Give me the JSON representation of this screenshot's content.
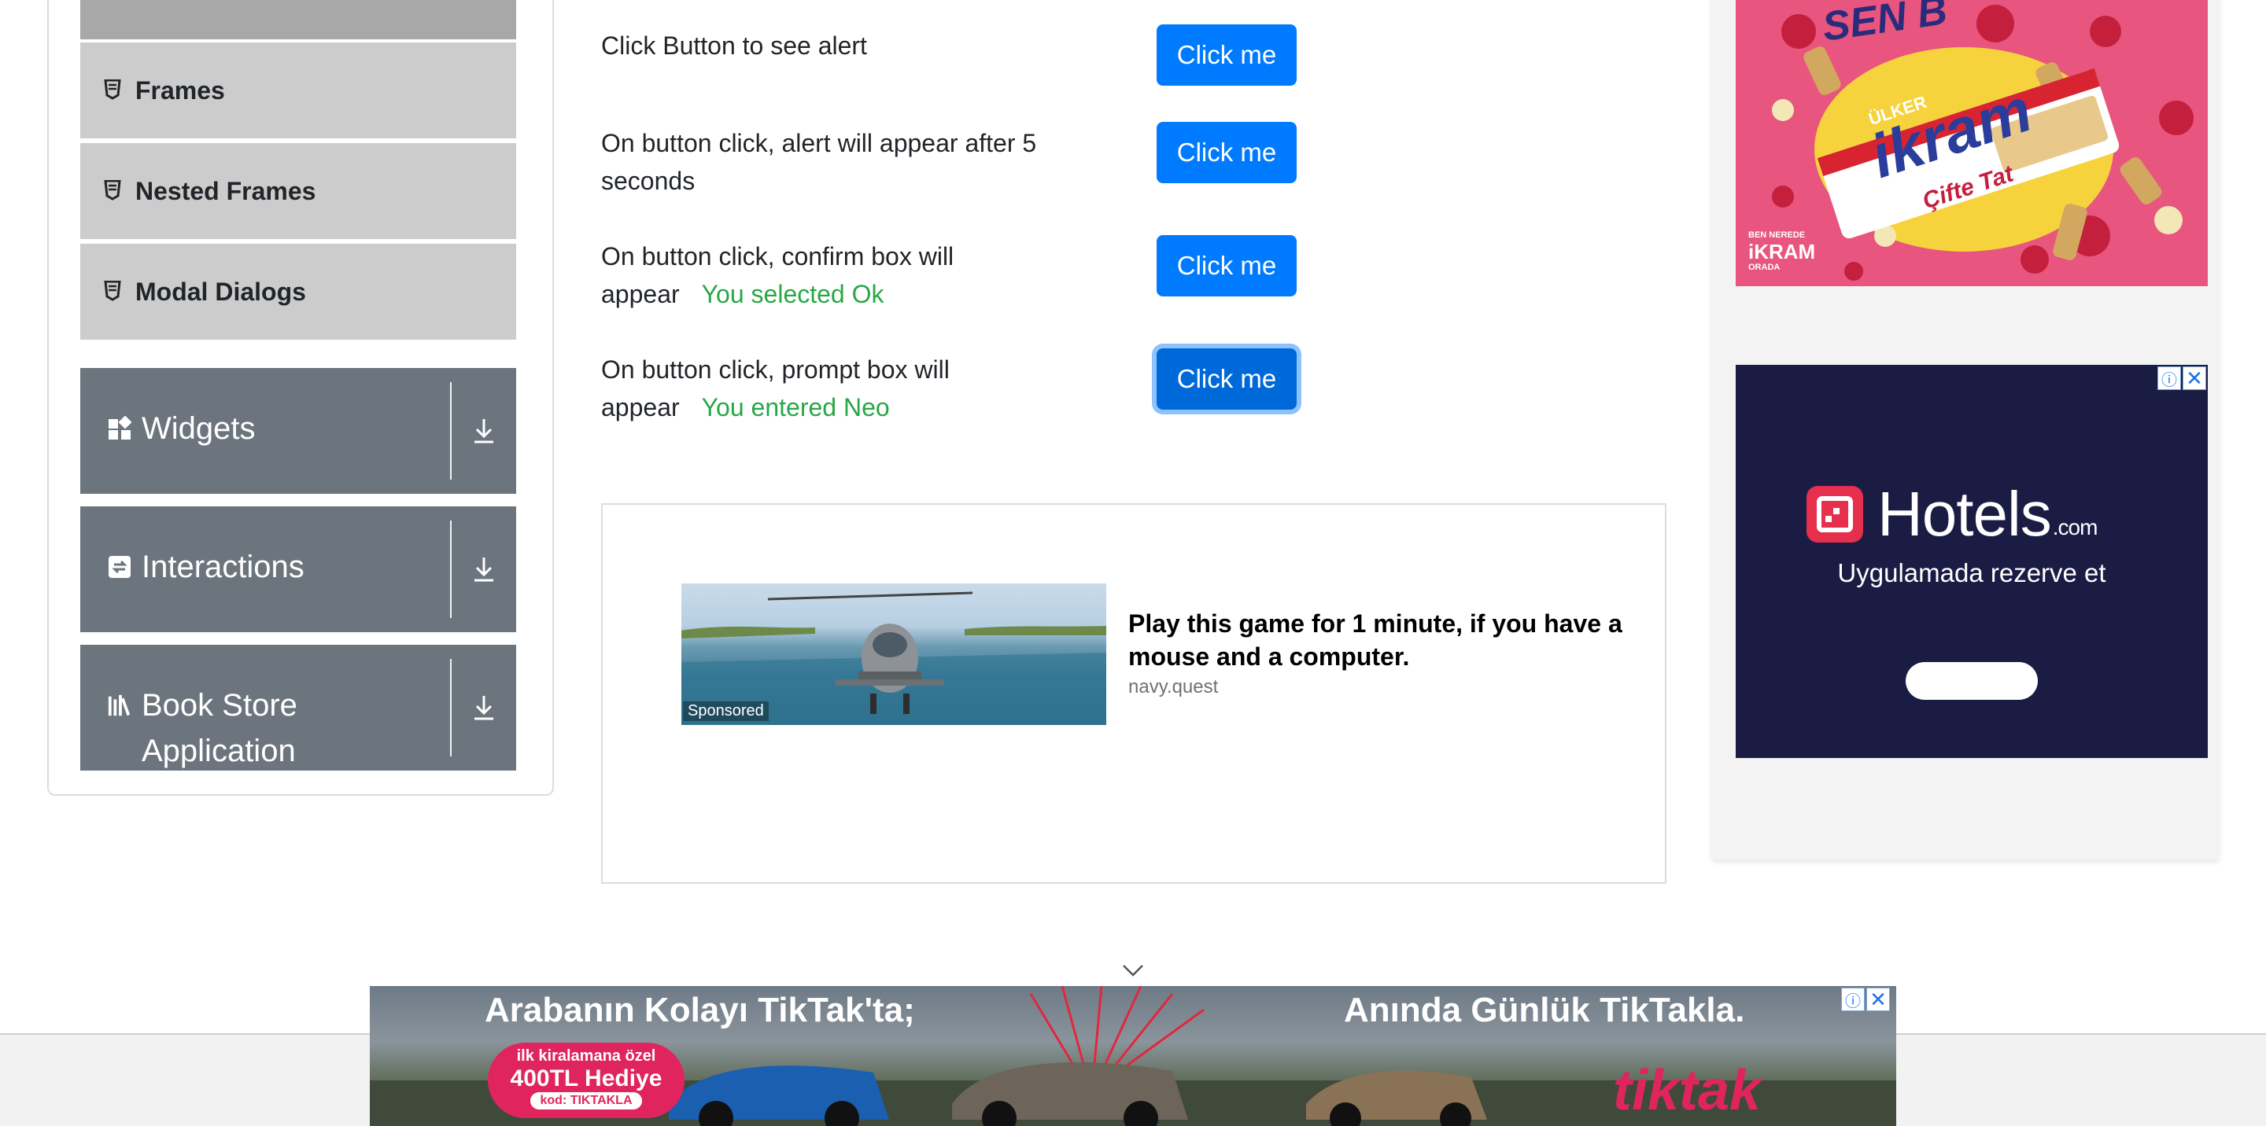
{
  "sidebar": {
    "sub_items": [
      {
        "label": "Frames"
      },
      {
        "label": "Nested Frames"
      },
      {
        "label": "Modal Dialogs"
      }
    ],
    "groups": [
      {
        "label": "Widgets"
      },
      {
        "label": "Interactions"
      },
      {
        "label": "Book Store Application"
      }
    ]
  },
  "alerts": {
    "rows": [
      {
        "text": "Click Button to see alert",
        "button": "Click me",
        "result": ""
      },
      {
        "text": "On button click, alert will appear after 5 seconds",
        "button": "Click me",
        "result": ""
      },
      {
        "text": "On button click, confirm box will appear",
        "button": "Click me",
        "result": "You selected Ok"
      },
      {
        "text": "On button click, prompt box will appear",
        "button": "Click me",
        "result": "You entered Neo"
      }
    ]
  },
  "sponsored_ad": {
    "badge": "Sponsored",
    "title": "Play this game for 1 minute, if you have a mouse and a computer.",
    "domain": "navy.quest"
  },
  "right_ads": {
    "hotels": {
      "brand": "Hotels",
      "brand_suffix": ".com",
      "tagline": "Uygulamada rezerve et"
    },
    "snack": {
      "headline": "SEN B",
      "brand": "ÜLKER",
      "product": "ikram",
      "variant": "Çifte Tat",
      "slogan_top": "BEN NEREDE",
      "slogan_mid": "iKRAM",
      "slogan_bottom": "ORADA"
    }
  },
  "bottom_ad": {
    "headline_left": "Arabanın Kolayı TikTak'ta;",
    "headline_right": "Anında Günlük TikTakla.",
    "promo_line1": "ilk kiralamana özel",
    "promo_line2": "400TL Hediye",
    "promo_code": "kod: TIKTAKLA",
    "brand": "tiktak"
  },
  "colors": {
    "primary_button": "#007bff",
    "success_text": "#28a745",
    "sidebar_group": "#6c757d",
    "sidebar_subitem": "#cccccc"
  }
}
